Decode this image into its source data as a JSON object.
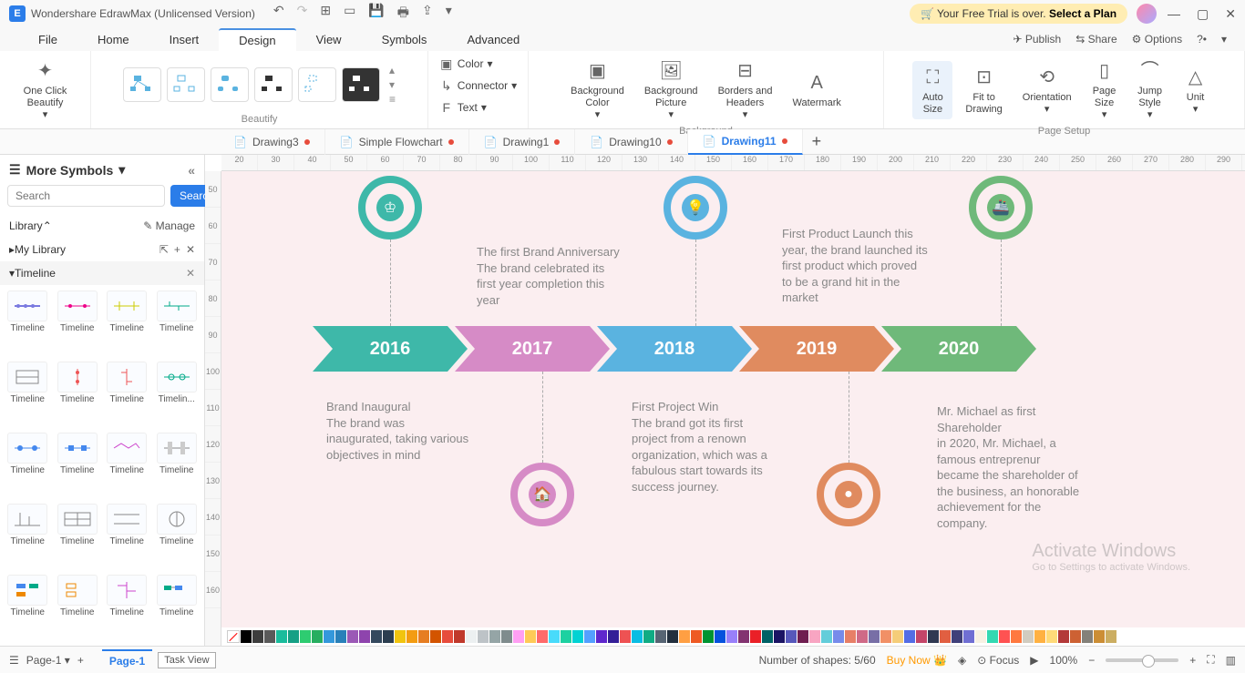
{
  "app": {
    "title": "Wondershare EdrawMax (Unlicensed Version)",
    "trial_msg_a": "Your Free Trial is over. ",
    "trial_msg_b": "Select a Plan"
  },
  "menu": {
    "tabs": [
      "File",
      "Home",
      "Insert",
      "Design",
      "View",
      "Symbols",
      "Advanced"
    ],
    "active": "Design",
    "publish": "Publish",
    "share": "Share",
    "options": "Options"
  },
  "ribbon": {
    "one_click": "One Click\nBeautify",
    "beautify": "Beautify",
    "color": "Color",
    "connector": "Connector",
    "text": "Text",
    "bg_color": "Background\nColor",
    "bg_picture": "Background\nPicture",
    "borders": "Borders and\nHeaders",
    "watermark": "Watermark",
    "background": "Background",
    "auto_size": "Auto\nSize",
    "fit": "Fit to\nDrawing",
    "orientation": "Orientation",
    "page_size": "Page\nSize",
    "jump_style": "Jump\nStyle",
    "unit": "Unit",
    "page_setup": "Page Setup"
  },
  "tabs": [
    {
      "name": "Drawing3",
      "dirty": true
    },
    {
      "name": "Simple Flowchart",
      "dirty": true
    },
    {
      "name": "Drawing1",
      "dirty": true
    },
    {
      "name": "Drawing10",
      "dirty": true
    },
    {
      "name": "Drawing11",
      "dirty": true,
      "active": true
    }
  ],
  "sidebar": {
    "title": "More Symbols",
    "search_btn": "Search",
    "search_ph": "Search",
    "library": "Library",
    "manage": "Manage",
    "mylib": "My Library",
    "section": "Timeline",
    "cell_label": "Timeline",
    "cell_label_trunc": "Timelin..."
  },
  "ruler_h": [
    "20",
    "30",
    "40",
    "50",
    "60",
    "70",
    "80",
    "90",
    "100",
    "110",
    "120",
    "130",
    "140",
    "150",
    "160",
    "170",
    "180",
    "190",
    "200",
    "210",
    "220",
    "230",
    "240",
    "250",
    "260",
    "270",
    "280",
    "290"
  ],
  "ruler_v": [
    "50",
    "60",
    "70",
    "80",
    "90",
    "100",
    "110",
    "120",
    "130",
    "140",
    "150",
    "160"
  ],
  "timeline": {
    "y2016": "2016",
    "y2017": "2017",
    "y2018": "2018",
    "y2019": "2019",
    "y2020": "2020",
    "t2016_title": "Brand Inaugural",
    "t2016_body": "The brand was inaugurated, taking various objectives in mind",
    "t2017_title": "The first Brand Anniversary",
    "t2017_body": "The brand celebrated its first year completion this year",
    "t2018_title": "First Project Win",
    "t2018_body": "The brand got its first project from a renown organization, which was a fabulous start towards its success journey.",
    "t2019_body": "First Product Launch this year, the brand launched its first product which proved to be a grand hit in the market",
    "t2020_title": "Mr. Michael as first Shareholder",
    "t2020_body": "in 2020, Mr. Michael, a famous entreprenur became the shareholder of the business, an honorable achievement for the company."
  },
  "status": {
    "page": "Page-1",
    "pagetab": "Page-1",
    "tooltip": "Task View",
    "shapes": "Number of shapes: 5/60",
    "buy": "Buy Now",
    "focus": "Focus",
    "zoom": "100%"
  },
  "watermark": {
    "l1": "Activate Windows",
    "l2": "Go to Settings to activate Windows."
  },
  "colors": [
    "#000",
    "#3d3d3d",
    "#5a5a5a",
    "#1abc9c",
    "#16a085",
    "#2ecc71",
    "#27ae60",
    "#3498db",
    "#2980b9",
    "#9b59b6",
    "#8e44ad",
    "#34495e",
    "#2c3e50",
    "#f1c40f",
    "#f39c12",
    "#e67e22",
    "#d35400",
    "#e74c3c",
    "#c0392b",
    "#ecf0f1",
    "#bdc3c7",
    "#95a5a6",
    "#7f8c8d",
    "#ff9ff3",
    "#feca57",
    "#ff6b6b",
    "#48dbfb",
    "#1dd1a1",
    "#00d2d3",
    "#54a0ff",
    "#5f27cd",
    "#341f97",
    "#ee5253",
    "#0abde3",
    "#10ac84",
    "#576574",
    "#222f3e",
    "#ff9f43",
    "#ee5a24",
    "#009432",
    "#0652dd",
    "#9980fa",
    "#833471",
    "#ea2027",
    "#006266",
    "#1b1464",
    "#5758bb",
    "#6f1e51",
    "#f8a5c2",
    "#63cdda",
    "#778beb",
    "#e77f67",
    "#cf6a87",
    "#786fa6",
    "#f19066",
    "#f5cd79",
    "#546de5",
    "#c44569",
    "#303952",
    "#e15f41",
    "#40407a",
    "#706fd3",
    "#f7f1e3",
    "#33d9b2",
    "#ff5252",
    "#ff793f",
    "#d1ccc0",
    "#ffb142",
    "#ffda79",
    "#b33939",
    "#cd6133",
    "#84817a",
    "#cc8e35",
    "#ccae62"
  ]
}
